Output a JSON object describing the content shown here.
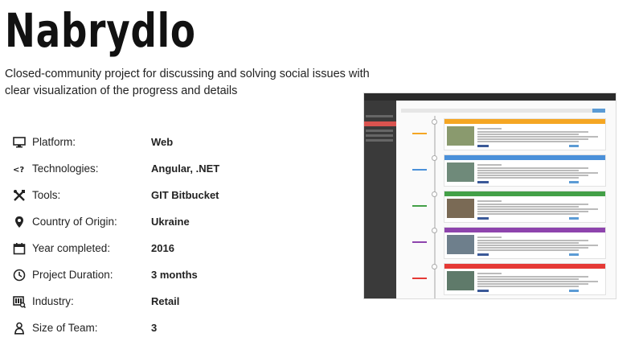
{
  "project": {
    "title": "Nabrydlo",
    "description": "Closed-community project for discussing and solving social issues with clear visualization of the progress and details"
  },
  "specs": [
    {
      "icon": "monitor-icon",
      "label": "Platform:",
      "value": "Web"
    },
    {
      "icon": "code-icon",
      "label": "Technologies:",
      "value": "Angular, .NET"
    },
    {
      "icon": "tools-icon",
      "label": "Tools:",
      "value": "GIT Bitbucket"
    },
    {
      "icon": "location-pin-icon",
      "label": "Country of Origin:",
      "value": "Ukraine"
    },
    {
      "icon": "calendar-icon",
      "label": "Year completed:",
      "value": "2016"
    },
    {
      "icon": "clock-icon",
      "label": "Project Duration:",
      "value": "3 months"
    },
    {
      "icon": "industry-icon",
      "label": "Industry:",
      "value": "Retail"
    },
    {
      "icon": "person-icon",
      "label": "Size of Team:",
      "value": "3"
    }
  ],
  "screenshot": {
    "icon": "app-screenshot-image",
    "cards": [
      {
        "color": "#f5a623",
        "time_color": "#f5a623"
      },
      {
        "color": "#4a90d9",
        "time_color": "#4a90d9"
      },
      {
        "color": "#43a047",
        "time_color": "#43a047"
      },
      {
        "color": "#8e44ad",
        "time_color": "#8e44ad"
      },
      {
        "color": "#e53935",
        "time_color": "#e53935"
      }
    ]
  }
}
